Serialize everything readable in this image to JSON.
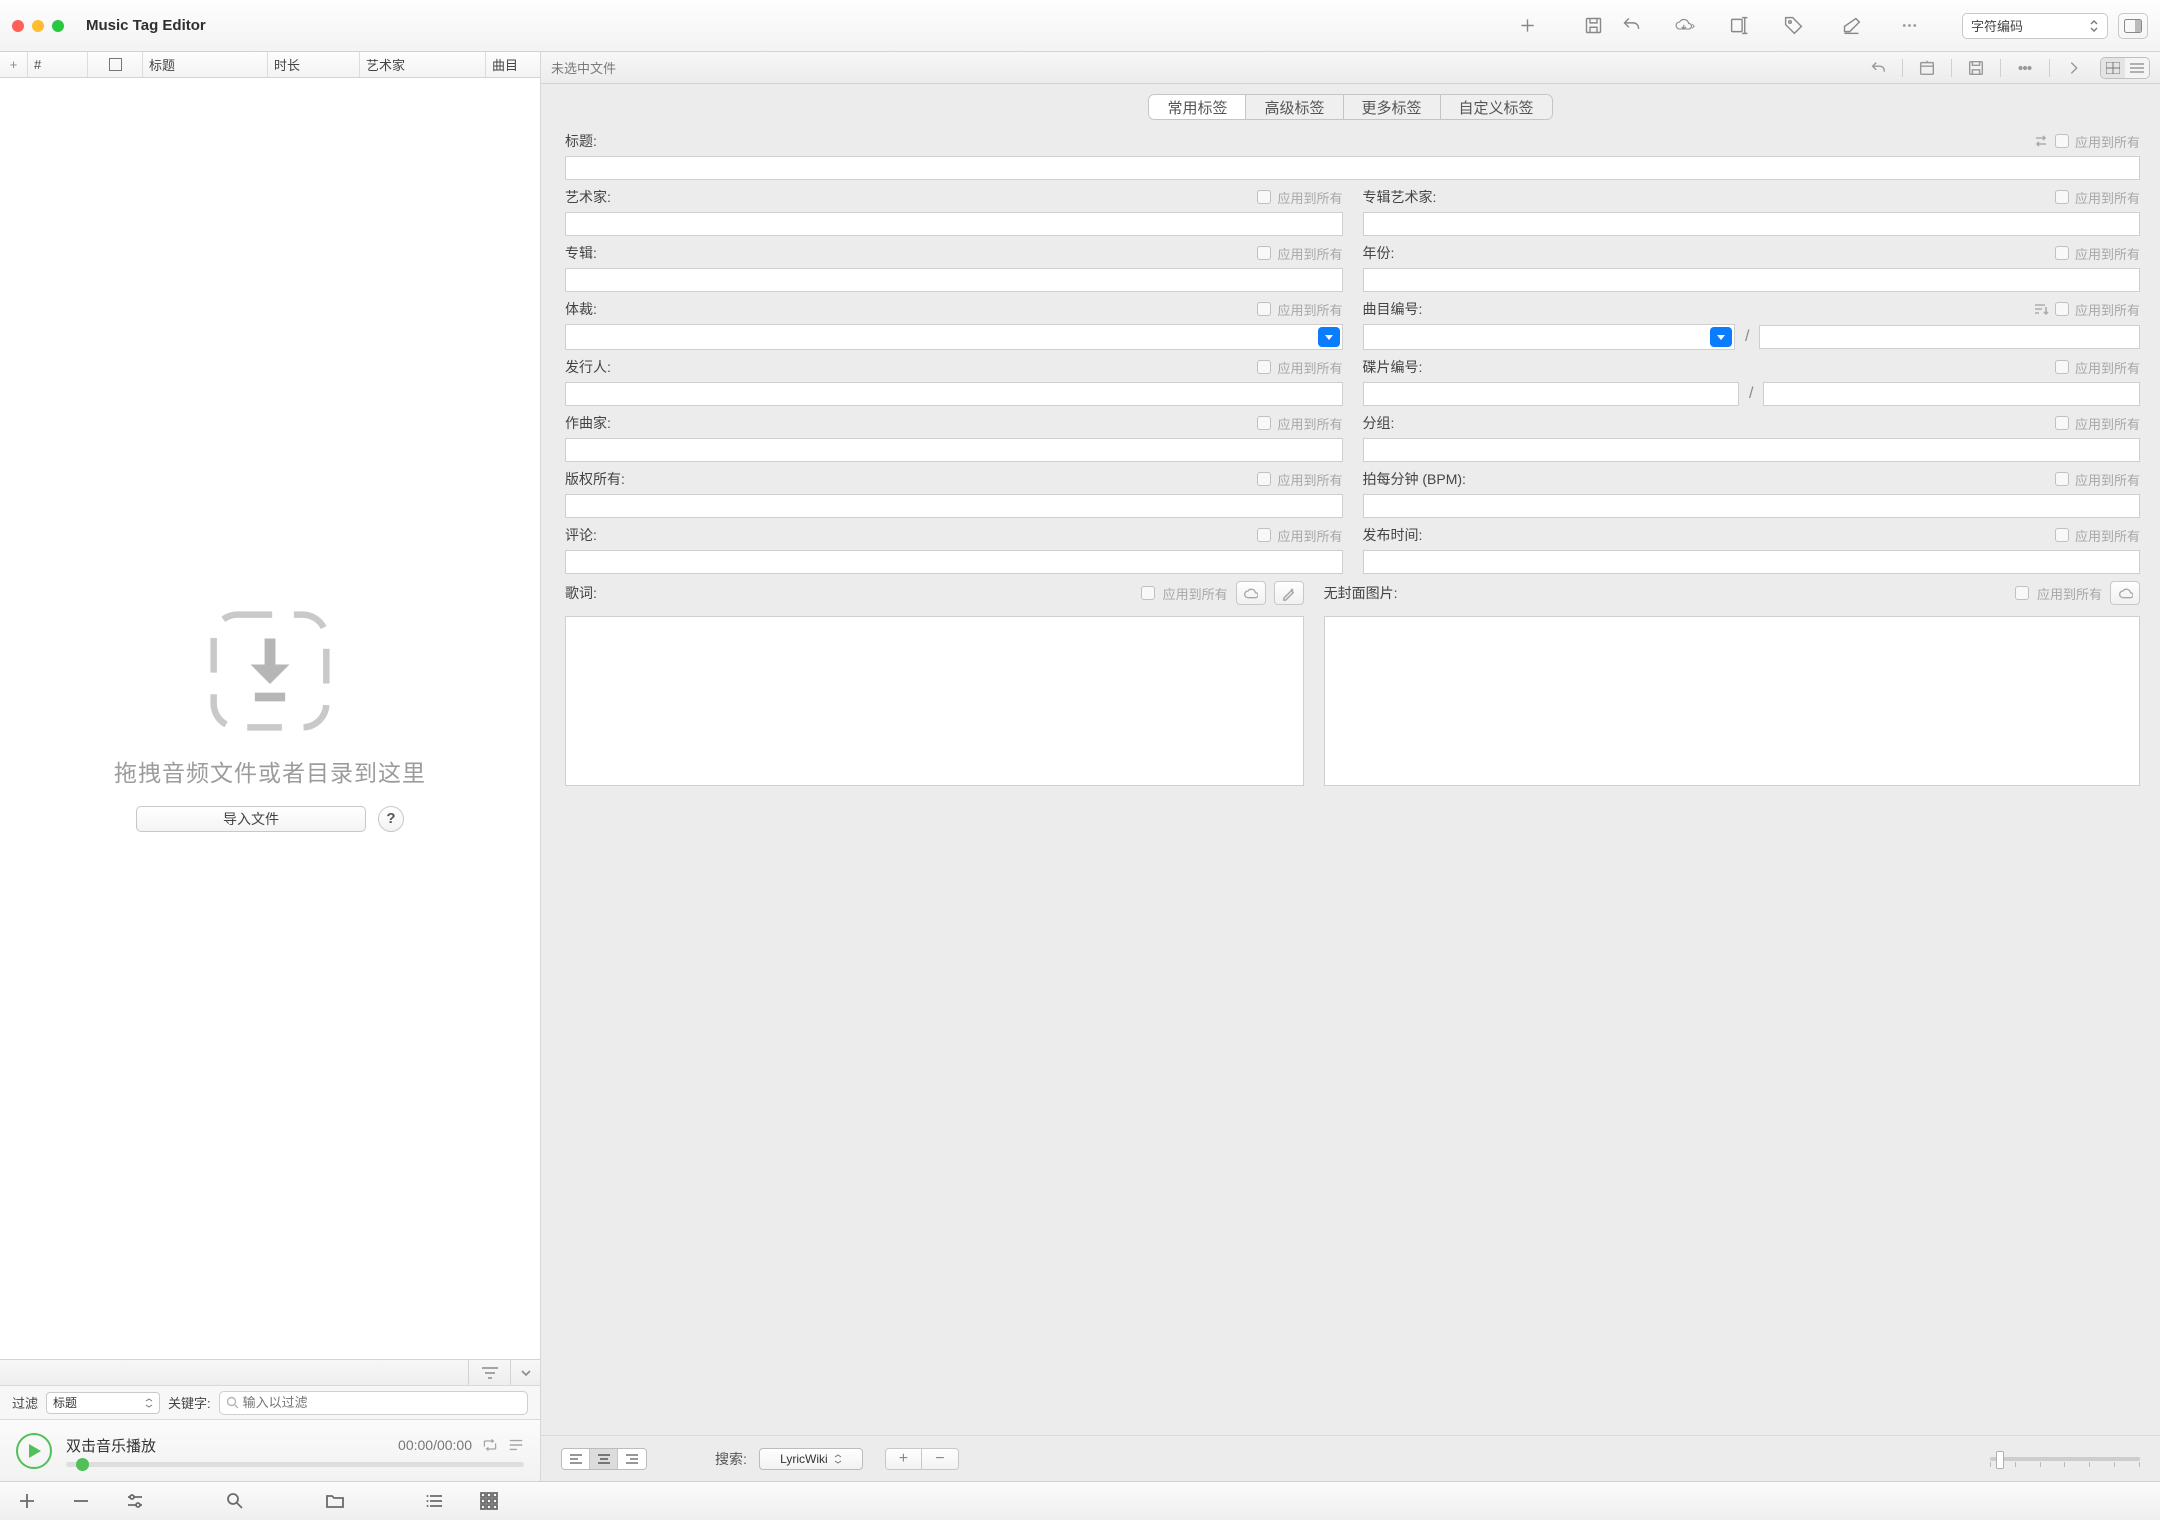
{
  "app": {
    "title": "Music Tag Editor"
  },
  "toolbar": {
    "encoding_label": "字符编码"
  },
  "list": {
    "columns": {
      "num": "#",
      "cover": "▢",
      "title": "标题",
      "duration": "时长",
      "artist": "艺术家",
      "track": "曲目"
    }
  },
  "drop": {
    "hint": "拖拽音频文件或者目录到这里",
    "import_btn": "导入文件",
    "help": "?"
  },
  "filter": {
    "label": "过滤",
    "by": "标题",
    "kw_label": "关键字:",
    "placeholder": "输入以过滤"
  },
  "player": {
    "hint": "双击音乐播放",
    "time": "00:00/00:00"
  },
  "detail": {
    "no_file": "未选中文件",
    "tabs": {
      "common": "常用标签",
      "advanced": "高级标签",
      "more": "更多标签",
      "custom": "自定义标签"
    },
    "labels": {
      "title": "标题:",
      "artist": "艺术家:",
      "album_artist": "专辑艺术家:",
      "album": "专辑:",
      "year": "年份:",
      "genre": "体裁:",
      "track_no": "曲目编号:",
      "publisher": "发行人:",
      "disc_no": "碟片编号:",
      "composer": "作曲家:",
      "grouping": "分组:",
      "copyright": "版权所有:",
      "bpm": "拍每分钟 (BPM):",
      "comment": "评论:",
      "release_time": "发布时间:",
      "lyrics": "歌词:",
      "no_cover": "无封面图片:"
    },
    "apply_all": "应用到所有",
    "search_label": "搜索:",
    "search_engine": "LyricWiki"
  }
}
